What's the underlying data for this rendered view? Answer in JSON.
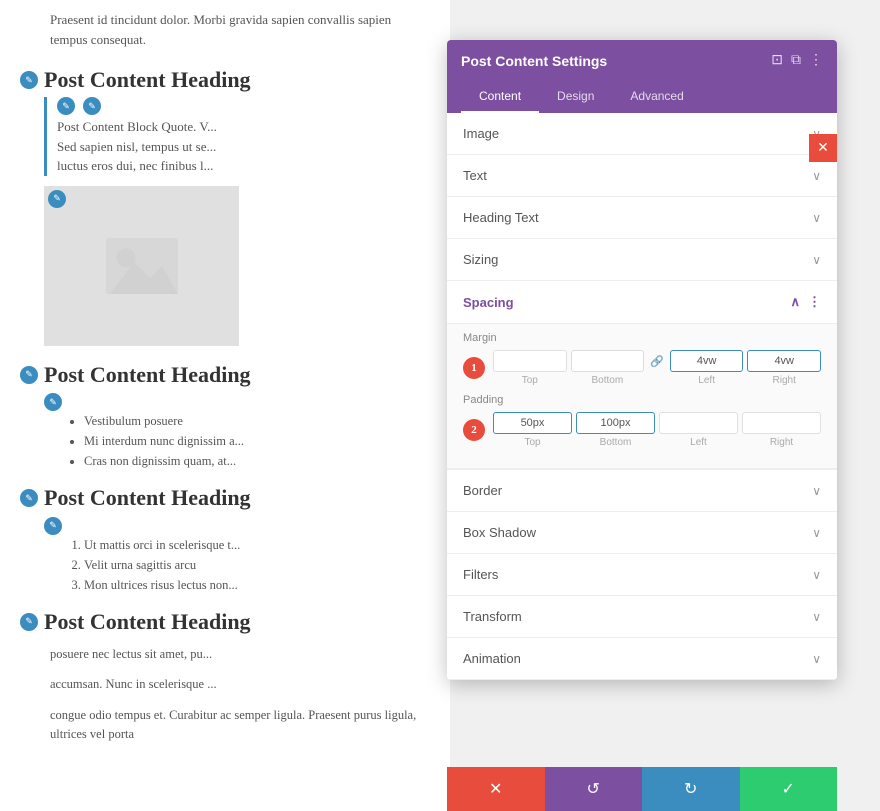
{
  "content": {
    "intro_text": "Praesent id tincidunt dolor. Morbi gravida sapien convallis sapien tempus consequat.",
    "heading1": "Post Content Heading",
    "blockquote_text": "Post Content Block Quote. V...",
    "blockquote_line2": "Sed sapien nisl, tempus ut se...",
    "blockquote_line3": "luctus eros dui, nec finibus l...",
    "heading2": "Post Content Heading",
    "bullet1": "Vestibulum posuere",
    "bullet2": "Mi interdum nunc dignissim a...",
    "bullet3": "Cras non dignissim quam, at...",
    "heading3": "Post Content Heading",
    "num1": "Ut mattis orci in scelerisque t...",
    "num2": "Velit urna sagittis arcu",
    "num3": "Mon ultrices risus lectus non...",
    "heading4": "Post Content Heading",
    "bottom1": "posuere nec lectus sit amet, pu...",
    "bottom2": "accumsan. Nunc in scelerisque ...",
    "bottom3": "congue odio tempus et. Curabitur ac semper ligula. Praesent purus ligula, ultrices vel porta"
  },
  "panel": {
    "title": "Post Content Settings",
    "tabs": [
      {
        "label": "Content",
        "active": true
      },
      {
        "label": "Design",
        "active": false
      },
      {
        "label": "Advanced",
        "active": false
      }
    ],
    "sections": [
      {
        "label": "Image",
        "open": false
      },
      {
        "label": "Text",
        "open": false
      },
      {
        "label": "Heading Text",
        "open": false
      },
      {
        "label": "Sizing",
        "open": false
      },
      {
        "label": "Spacing",
        "open": true
      },
      {
        "label": "Border",
        "open": false
      },
      {
        "label": "Box Shadow",
        "open": false
      },
      {
        "label": "Filters",
        "open": false
      },
      {
        "label": "Transform",
        "open": false
      },
      {
        "label": "Animation",
        "open": false
      }
    ],
    "spacing": {
      "margin": {
        "badge": "1",
        "top_value": "",
        "bottom_value": "",
        "left_value": "4vw",
        "right_value": "4vw",
        "top_label": "Top",
        "bottom_label": "Bottom",
        "left_label": "Left",
        "right_label": "Right"
      },
      "padding": {
        "badge": "2",
        "top_value": "50px",
        "bottom_value": "100px",
        "left_value": "",
        "right_value": "",
        "top_label": "Top",
        "bottom_label": "Bottom",
        "left_label": "Left",
        "right_label": "Right"
      }
    }
  },
  "toolbar": {
    "cancel_icon": "✕",
    "reset_icon": "↺",
    "redo_icon": "↻",
    "save_icon": "✓"
  },
  "icons": {
    "minimize": "⊡",
    "expand": "⧉",
    "more": "⋮",
    "chevron_down": "∨",
    "chevron_up": "∧"
  }
}
